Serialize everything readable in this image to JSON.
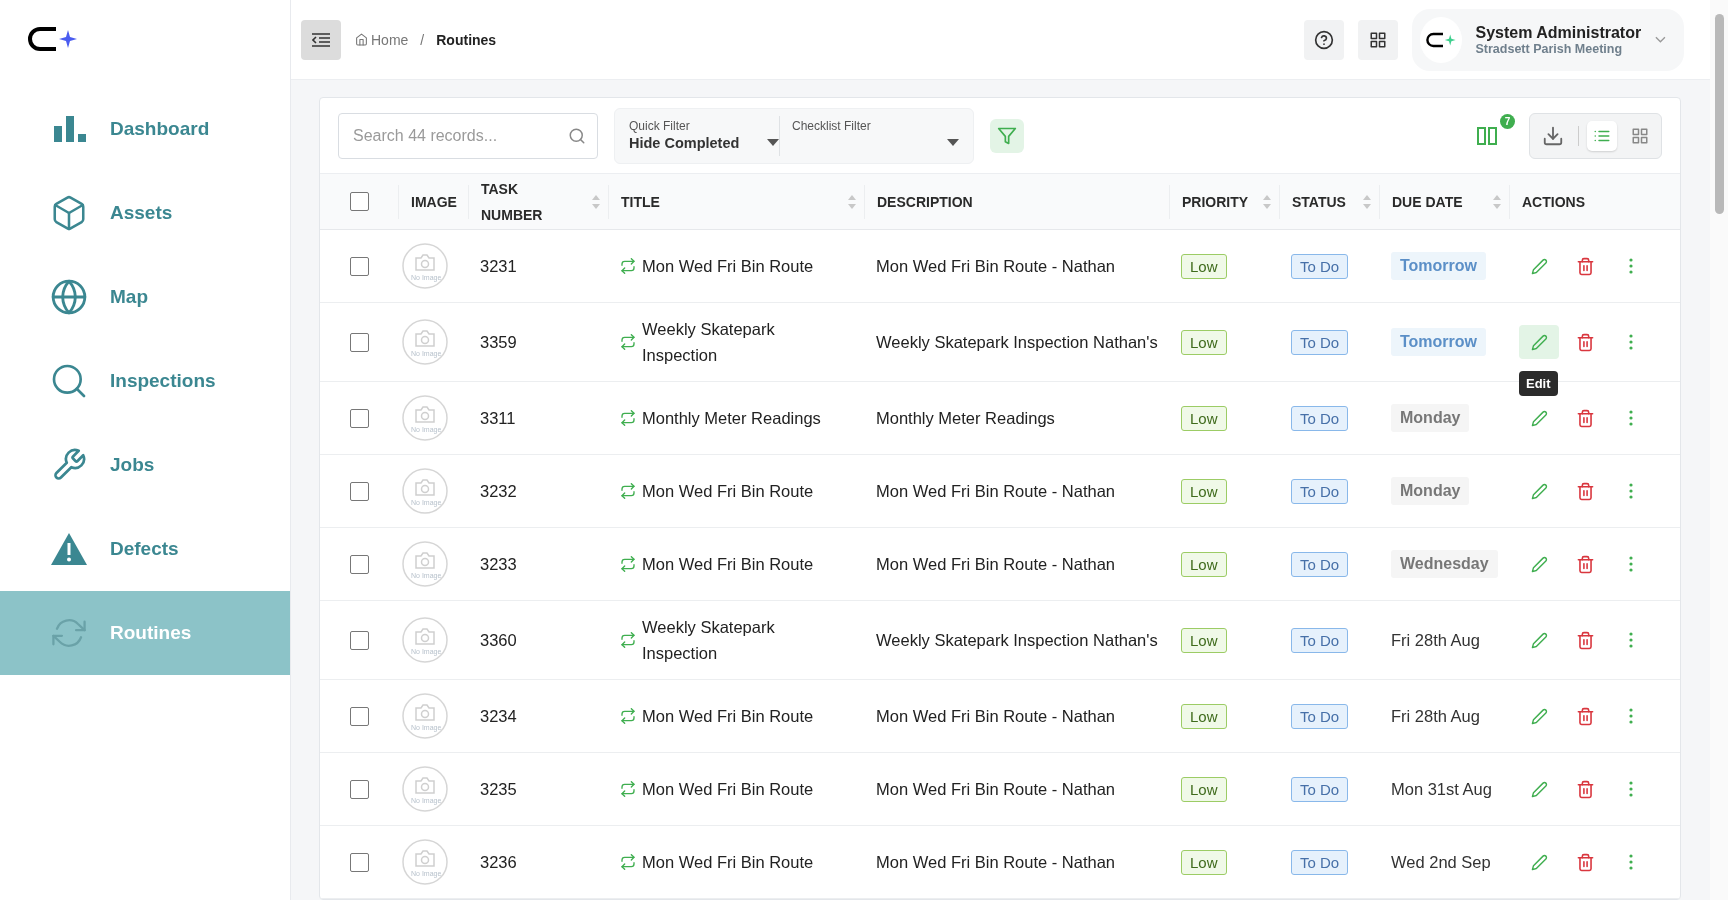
{
  "sidebar": {
    "items": [
      {
        "label": "Dashboard",
        "kind": "dashboard",
        "selected": false
      },
      {
        "label": "Assets",
        "kind": "assets",
        "selected": false
      },
      {
        "label": "Map",
        "kind": "map",
        "selected": false
      },
      {
        "label": "Inspections",
        "kind": "inspections",
        "selected": false
      },
      {
        "label": "Jobs",
        "kind": "jobs",
        "selected": false
      },
      {
        "label": "Defects",
        "kind": "defects",
        "selected": false
      },
      {
        "label": "Routines",
        "kind": "routines",
        "selected": true
      }
    ]
  },
  "header": {
    "breadcrumb": [
      "Home",
      "/",
      "Routines"
    ],
    "user": {
      "name": "System Administrator",
      "org": "Stradsett Parish Meeting"
    }
  },
  "toolbar": {
    "search": {
      "placeholder": "Search 44 records..."
    },
    "quick_filter": {
      "label": "Quick Filter",
      "value": "Hide Completed"
    },
    "checklist_filter": {
      "label": "Checklist Filter"
    },
    "columns_badge": "7",
    "views": [
      {
        "kind": "list",
        "selected": true
      },
      {
        "kind": "grid",
        "selected": false
      }
    ]
  },
  "table": {
    "select_all_checked": false,
    "columns": [
      {
        "label": "IMAGE",
        "sortable": false
      },
      {
        "label": "TASK NUMBER",
        "sortable": true
      },
      {
        "label": "TITLE",
        "sortable": true
      },
      {
        "label": "DESCRIPTION",
        "sortable": false
      },
      {
        "label": "PRIORITY",
        "sortable": true
      },
      {
        "label": "STATUS",
        "sortable": true
      },
      {
        "label": "DUE DATE",
        "sortable": true
      },
      {
        "label": "ACTIONS",
        "sortable": false
      }
    ],
    "rows": [
      {
        "checked": false,
        "image": "No Image",
        "task_number": "3231",
        "title": "Mon Wed Fri Bin Route",
        "description": "Mon Wed Fri Bin Route - Nathan",
        "priority": "Low",
        "status": "To Do",
        "due": {
          "text": "Tomorrow",
          "kind": "soon"
        }
      },
      {
        "checked": false,
        "image": "No Image",
        "task_number": "3359",
        "title": "Weekly Skatepark Inspection",
        "description": "Weekly Skatepark Inspection Nathan's",
        "priority": "Low",
        "status": "To Do",
        "due": {
          "text": "Tomorrow",
          "kind": "soon"
        },
        "edit_tooltip": "Edit"
      },
      {
        "checked": false,
        "image": "No Image",
        "task_number": "3311",
        "title": "Monthly Meter Readings",
        "description": "Monthly Meter Readings",
        "priority": "Low",
        "status": "To Do",
        "due": {
          "text": "Monday",
          "kind": "week"
        }
      },
      {
        "checked": false,
        "image": "No Image",
        "task_number": "3232",
        "title": "Mon Wed Fri Bin Route",
        "description": "Mon Wed Fri Bin Route - Nathan",
        "priority": "Low",
        "status": "To Do",
        "due": {
          "text": "Monday",
          "kind": "week"
        }
      },
      {
        "checked": false,
        "image": "No Image",
        "task_number": "3233",
        "title": "Mon Wed Fri Bin Route",
        "description": "Mon Wed Fri Bin Route - Nathan",
        "priority": "Low",
        "status": "To Do",
        "due": {
          "text": "Wednesday",
          "kind": "week"
        }
      },
      {
        "checked": false,
        "image": "No Image",
        "task_number": "3360",
        "title": "Weekly Skatepark Inspection",
        "description": "Weekly Skatepark Inspection Nathan's",
        "priority": "Low",
        "status": "To Do",
        "due": {
          "text": "Fri 28th Aug",
          "kind": "plain"
        }
      },
      {
        "checked": false,
        "image": "No Image",
        "task_number": "3234",
        "title": "Mon Wed Fri Bin Route",
        "description": "Mon Wed Fri Bin Route - Nathan",
        "priority": "Low",
        "status": "To Do",
        "due": {
          "text": "Fri 28th Aug",
          "kind": "plain"
        }
      },
      {
        "checked": false,
        "image": "No Image",
        "task_number": "3235",
        "title": "Mon Wed Fri Bin Route",
        "description": "Mon Wed Fri Bin Route - Nathan",
        "priority": "Low",
        "status": "To Do",
        "due": {
          "text": "Mon 31st Aug",
          "kind": "plain"
        }
      },
      {
        "checked": false,
        "image": "No Image",
        "task_number": "3236",
        "title": "Mon Wed Fri Bin Route",
        "description": "Mon Wed Fri Bin Route - Nathan",
        "priority": "Low",
        "status": "To Do",
        "due": {
          "text": "Wed 2nd Sep",
          "kind": "plain"
        }
      }
    ]
  }
}
